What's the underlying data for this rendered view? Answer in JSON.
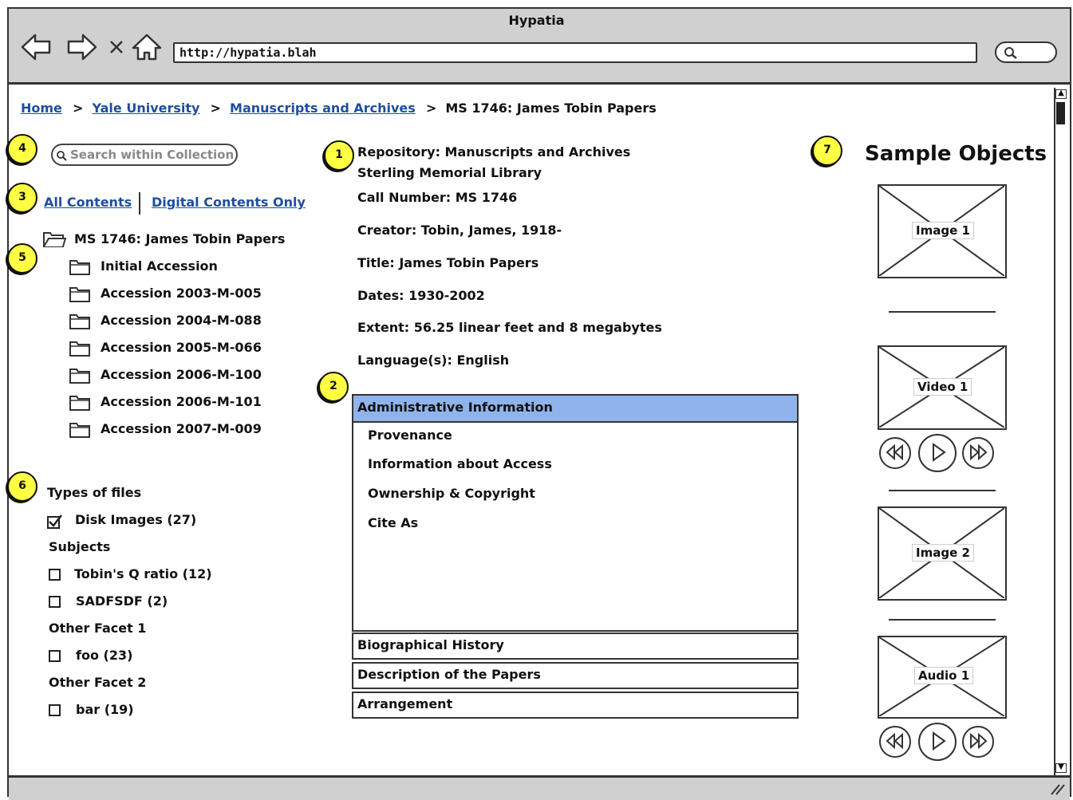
{
  "window": {
    "title": "Hypatia",
    "url": "http://hypatia.blah"
  },
  "nav_icons": [
    "back-arrow-icon",
    "forward-arrow-icon",
    "close-icon",
    "home-icon",
    "search-icon"
  ],
  "breadcrumb": {
    "items": [
      "Home",
      "Yale University",
      "Manuscripts and Archives"
    ],
    "current": "MS 1746: James Tobin Papers",
    "separator": ">"
  },
  "markers": [
    "1",
    "2",
    "3",
    "4",
    "5",
    "6",
    "7"
  ],
  "search": {
    "placeholder": "Search within Collection"
  },
  "contents_toggle": {
    "all": "All Contents",
    "digital": "Digital Contents Only"
  },
  "tree": {
    "root": "MS 1746: James Tobin Papers",
    "children": [
      "Initial Accession",
      "Accession 2003-M-005",
      "Accession 2004-M-088",
      "Accession 2005-M-066",
      "Accession 2006-M-100",
      "Accession 2006-M-101",
      "Accession 2007-M-009"
    ]
  },
  "facets": {
    "types_heading": "Types of files",
    "types": [
      {
        "label": "Disk Images (27)",
        "checked": true
      }
    ],
    "subjects_heading": "Subjects",
    "subjects": [
      {
        "label": "Tobin's Q ratio (12)",
        "checked": false
      },
      {
        "label": "SADFSDF (2)",
        "checked": false
      }
    ],
    "other1_heading": "Other Facet 1",
    "other1": [
      {
        "label": "foo (23)",
        "checked": false
      }
    ],
    "other2_heading": "Other Facet 2",
    "other2": [
      {
        "label": "bar (19)",
        "checked": false
      }
    ]
  },
  "details": {
    "repository": "Repository: Manuscripts and Archives",
    "repository_line2": "Sterling Memorial Library",
    "call_number": "Call Number: MS 1746",
    "creator": "Creator: Tobin, James, 1918-",
    "title": "Title: James Tobin Papers",
    "dates": "Dates: 1930-2002",
    "extent": "Extent: 56.25 linear feet and 8 megabytes",
    "language": "Language(s): English"
  },
  "accordion": {
    "active": "Administrative Information",
    "active_items": [
      "Provenance",
      "Information about Access",
      "Ownership & Copyright",
      "Cite As"
    ],
    "sections": [
      "Biographical History",
      "Description of the Papers",
      "Arrangement"
    ],
    "active_color": "#8fb4ec"
  },
  "sample_objects": {
    "heading": "Sample Objects",
    "items": [
      "Image 1",
      "Video 1",
      "Image 2",
      "Audio 1"
    ]
  },
  "colors": {
    "chrome": "#d0d0d0",
    "link": "#1f4e9e",
    "marker": "#ffff44"
  }
}
